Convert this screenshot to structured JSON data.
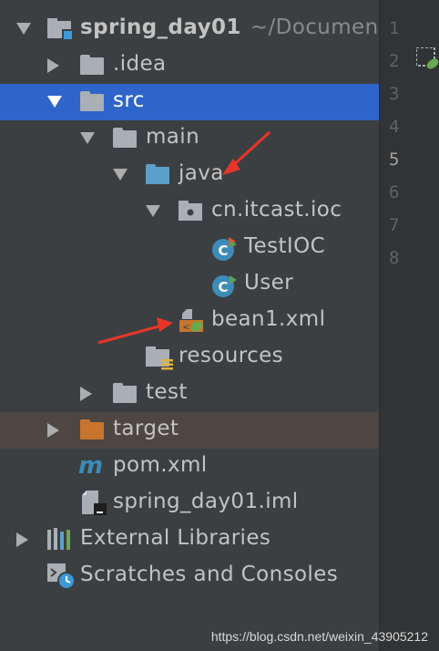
{
  "tree": {
    "project": {
      "name": "spring_day01",
      "path": "~/Documents"
    },
    "idea": ".idea",
    "src": "src",
    "main": "main",
    "java": "java",
    "package": "cn.itcast.ioc",
    "class1": "TestIOC",
    "class2": "User",
    "bean": "bean1.xml",
    "resources": "resources",
    "test": "test",
    "target": "target",
    "pom": "pom.xml",
    "iml": "spring_day01.iml",
    "external": "External Libraries",
    "scratches": "Scratches and Consoles"
  },
  "gutter": {
    "lines": [
      "1",
      "2",
      "3",
      "4",
      "5",
      "6",
      "7",
      "8"
    ],
    "current": "5"
  },
  "watermark": "https://blog.csdn.net/weixin_43905212",
  "colors": {
    "selection": "#2f65ca",
    "target_highlight": "#4d4643",
    "folder": "#a9afb4",
    "source_folder": "#5aa0cb",
    "excluded_folder": "#c8742e",
    "arrow_annotation": "#e8352a"
  }
}
